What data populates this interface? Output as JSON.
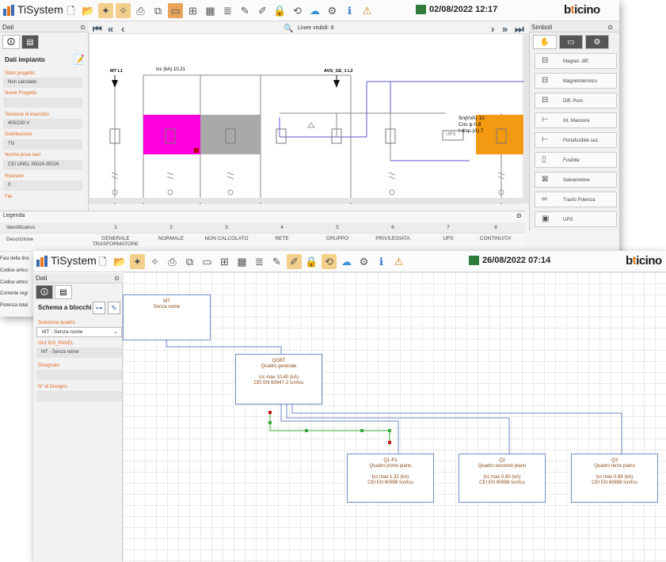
{
  "app": {
    "title": "TiSystem",
    "brand": "bticino"
  },
  "window1": {
    "datetime": "02/08/2022 12:17",
    "left_panel_header": "Dati",
    "right_panel_header": "Simboli",
    "left_title": "Dati impianto",
    "fields": [
      {
        "label": "Stato progetto",
        "value": "Non calcolato"
      },
      {
        "label": "Nome Progetto",
        "value": ""
      },
      {
        "label": "Tensione di esercizio",
        "value": "400/230 V"
      },
      {
        "label": "Distribuzione",
        "value": "TN"
      },
      {
        "label": "Norma posa cavi",
        "value": "CEI UNEL 35024-35026"
      },
      {
        "label": "Riserave",
        "value": "0"
      },
      {
        "label": "File",
        "value": ""
      }
    ],
    "visible_lines": "Linee visibili: 8",
    "diagram": {
      "label_mt": "MT L1",
      "label_icc": "Icc (kA) 10,21",
      "label_avg": "AVG_GE_1 L2",
      "label_ups": "UPS",
      "label_sn": "Sn(kVA) 10",
      "label_cos": "Cos φ 0,8",
      "label_idisp": "I disp.(A) 7"
    },
    "symbols": [
      "Magnet. diff.",
      "Magnetotermico",
      "Diff. Puro",
      "Int. Manovra",
      "Portafusibile sez.",
      "Fusibile",
      "Salvamotore",
      "Trasfo Potenza",
      "UPS"
    ],
    "legend": {
      "header": "Legenda",
      "id_label": "Identificativo",
      "desc_label": "Descrizione",
      "ids": [
        "1",
        "2",
        "3",
        "4",
        "5",
        "6",
        "7",
        "8"
      ],
      "descriptions": [
        "GENERALE TRASFORMATORE",
        "NORMALE",
        "NON CALCOLATO",
        "RETE",
        "GRUPPO",
        "PRIVILEGIATA",
        "UPS",
        "CONTINUITA'"
      ]
    },
    "extra_rows": [
      "Fasi della line",
      "Codice artico",
      "Codice artico",
      "Corrente regi",
      "Potenza total"
    ]
  },
  "window2": {
    "datetime": "26/08/2022 07:14",
    "left_panel_header": "Dati",
    "left_title": "Schema a blocchi",
    "fields": [
      {
        "label": "Seleziona quadro",
        "value": "MT - Senza nome",
        "type": "select"
      },
      {
        "label": "GUI IDS_PANEL",
        "value": "MT - Senza nome"
      },
      {
        "label": "Disegnato",
        "value": ""
      },
      {
        "label": "N° di Disegno",
        "value": ""
      }
    ],
    "blocks": [
      {
        "id": "mt",
        "name": "MT",
        "desc": "Senza nome",
        "icc": "",
        "norm": ""
      },
      {
        "id": "qgbt",
        "name": "QGBT",
        "desc": "Quadro generale",
        "icc": "Icc max 10,40 (kA)",
        "norm": "CEI EN 60947-2 Icn/Icu"
      },
      {
        "id": "q1",
        "name": "Q1-P1",
        "desc": "Quadro primo piano",
        "icc": "Icc max 1,32 (kA)",
        "norm": "CEI EN 60898 Icn/Icu"
      },
      {
        "id": "q2",
        "name": "Q2",
        "desc": "Quadro secondo piano",
        "icc": "Icc max 0,90 (kA)",
        "norm": "CEI EN 60898 Icn/Icu"
      },
      {
        "id": "q3",
        "name": "Q3",
        "desc": "Quadro terzo piano",
        "icc": "Icc max 0,68 (kA)",
        "norm": "CEI EN 60898 Icn/Icu"
      }
    ]
  },
  "colors": {
    "accent": "#e06a23",
    "magenta": "#ff00dd",
    "orange": "#f49a12",
    "gray": "#a9a9a9",
    "line_blue": "#5a5ad6",
    "box_border": "#6d8dc7"
  }
}
